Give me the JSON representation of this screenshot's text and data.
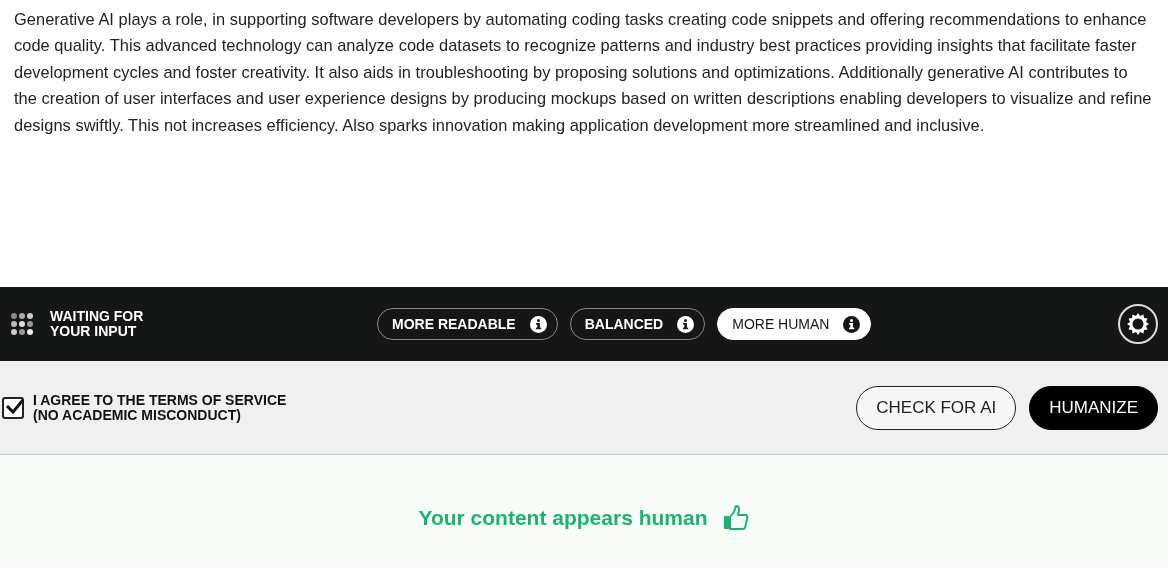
{
  "output_text": "Generative AI plays a role, in supporting software developers by automating coding tasks creating code snippets and offering recommendations to enhance code quality. This advanced technology can analyze code datasets to recognize patterns and industry best practices providing insights that facilitate faster development cycles and foster creativity. It also aids in troubleshooting by proposing solutions and optimizations. Additionally generative AI contributes to the creation of user interfaces and user experience designs by producing mockups based on written descriptions enabling developers to visualize and refine designs swiftly. This not increases efficiency. Also sparks innovation making application development more streamlined and inclusive.",
  "toolbar": {
    "status": "WAITING FOR\nYOUR INPUT",
    "modes": [
      {
        "label": "MORE READABLE",
        "selected": false
      },
      {
        "label": "BALANCED",
        "selected": false
      },
      {
        "label": "MORE HUMAN",
        "selected": true
      }
    ]
  },
  "agreement": {
    "label": "I AGREE TO THE TERMS OF SERVICE\n(NO ACADEMIC MISCONDUCT)",
    "checked": true
  },
  "buttons": [
    {
      "label": "CHECK FOR AI",
      "kind": "outline"
    },
    {
      "label": "HUMANIZE",
      "kind": "filled"
    }
  ],
  "result": {
    "message": "Your content appears human"
  }
}
